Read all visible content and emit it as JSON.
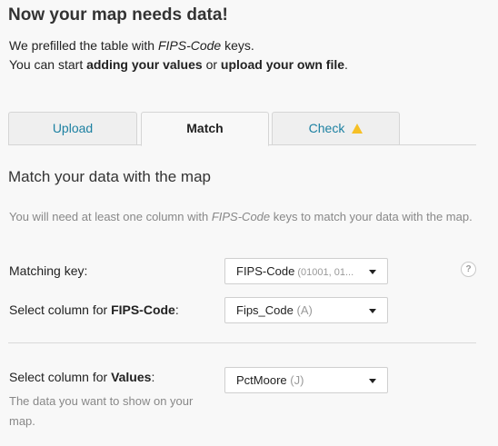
{
  "title": "Now your map needs data!",
  "intro": {
    "line1_a": "We prefilled the table with ",
    "line1_key": "FIPS-Code",
    "line1_b": " keys.",
    "line2_a": "You can start ",
    "line2_add": "adding your values",
    "line2_or": " or ",
    "line2_upload": "upload your own file",
    "line2_end": "."
  },
  "tabs": [
    {
      "label": "Upload"
    },
    {
      "label": "Match"
    },
    {
      "label": "Check"
    }
  ],
  "section": {
    "title": "Match your data with the map",
    "help_a": "You will need at least one column with ",
    "help_key": "FIPS-Code",
    "help_b": " keys to match your data with the map."
  },
  "matching_key": {
    "label": "Matching key:",
    "value": "FIPS-Code",
    "hint": " (01001, 01..."
  },
  "fips_column": {
    "label_a": "Select column for ",
    "label_b": "FIPS-Code",
    "label_c": ":",
    "value": "Fips_Code",
    "hint": " (A)"
  },
  "values_column": {
    "label_a": "Select column for ",
    "label_b": "Values",
    "label_c": ":",
    "sublabel": "The data you want to show on your map.",
    "value": "PctMoore",
    "hint": " (J)"
  },
  "help_icon": "?",
  "icons": {
    "warning": "warning-icon",
    "help": "question-icon",
    "caret": "chevron-down-icon"
  },
  "colors": {
    "accent": "#1d81a2",
    "warning": "#f6c026",
    "background": "#f8f8f8"
  }
}
